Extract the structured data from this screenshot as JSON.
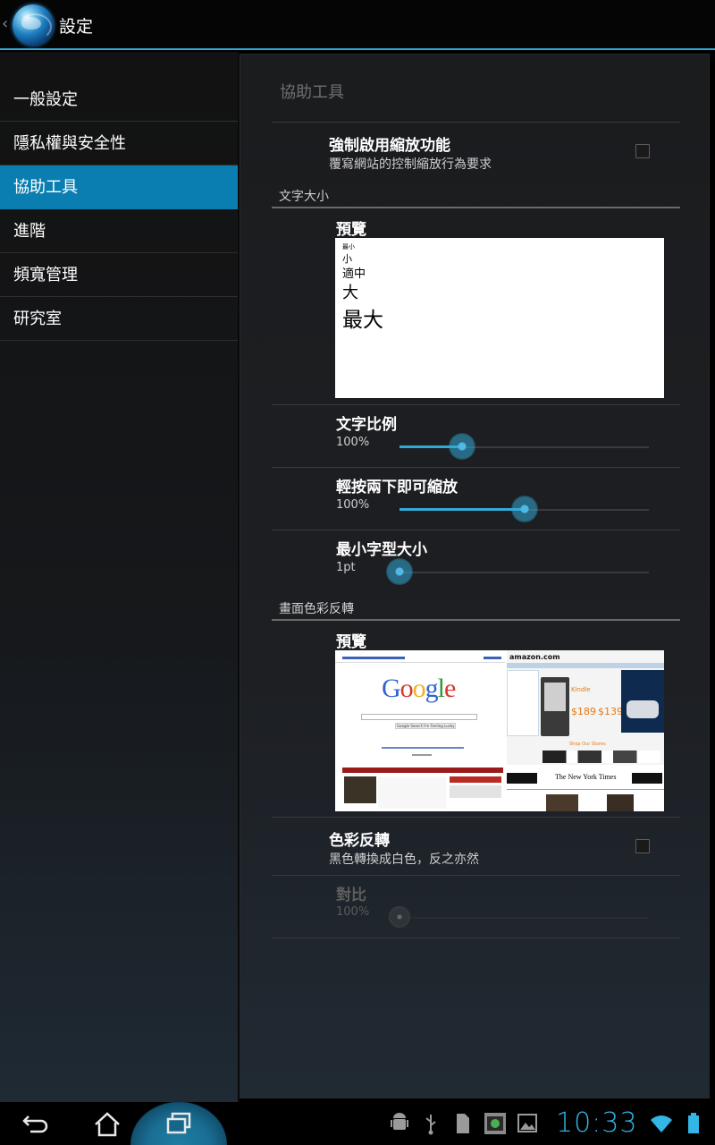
{
  "actionbar": {
    "title": "設定"
  },
  "sidebar": {
    "items": [
      {
        "label": "一般設定",
        "active": false
      },
      {
        "label": "隱私權與安全性",
        "active": false
      },
      {
        "label": "協助工具",
        "active": true
      },
      {
        "label": "進階",
        "active": false
      },
      {
        "label": "頻寬管理",
        "active": false
      },
      {
        "label": "研究室",
        "active": false
      }
    ]
  },
  "main": {
    "title": "協助工具",
    "force_zoom": {
      "title": "強制啟用縮放功能",
      "summary": "覆寫網站的控制縮放行為要求",
      "checked": false
    },
    "text_size_category": "文字大小",
    "text_preview": {
      "label": "預覽",
      "samples": [
        "最小",
        "小",
        "適中",
        "大",
        "最大"
      ]
    },
    "text_scaling": {
      "title": "文字比例",
      "value": "100%",
      "fraction": 0.25
    },
    "double_tap_zoom": {
      "title": "輕按兩下即可縮放",
      "value": "100%",
      "fraction": 0.5
    },
    "min_font_size": {
      "title": "最小字型大小",
      "value": "1pt",
      "fraction": 0.0
    },
    "inverted_category": "畫面色彩反轉",
    "inverted_preview": {
      "label": "預覽",
      "google_logo": "Google",
      "google_buttons": [
        "Google Search",
        "I'm Feeling Lucky"
      ],
      "amazon_logo": "amazon.com",
      "kindle_text": "Kindle",
      "price_1": "$189",
      "price_2": "$139",
      "nyt_logo": "The New York Times",
      "shop_text": "Shop Our Stores"
    },
    "invert_colors": {
      "title": "色彩反轉",
      "summary": "黑色轉換成白色，反之亦然",
      "checked": false
    },
    "contrast": {
      "title": "對比",
      "value": "100%",
      "fraction": 0.0,
      "enabled": false
    }
  },
  "statusbar": {
    "time": "10:33",
    "icons": [
      "android-debug-icon",
      "usb-icon",
      "sd-card-icon",
      "screenshot-icon",
      "gallery-icon",
      "wifi-icon",
      "battery-icon"
    ]
  },
  "colors": {
    "accent": "#33a9d6",
    "selected": "#0a7eb1"
  }
}
